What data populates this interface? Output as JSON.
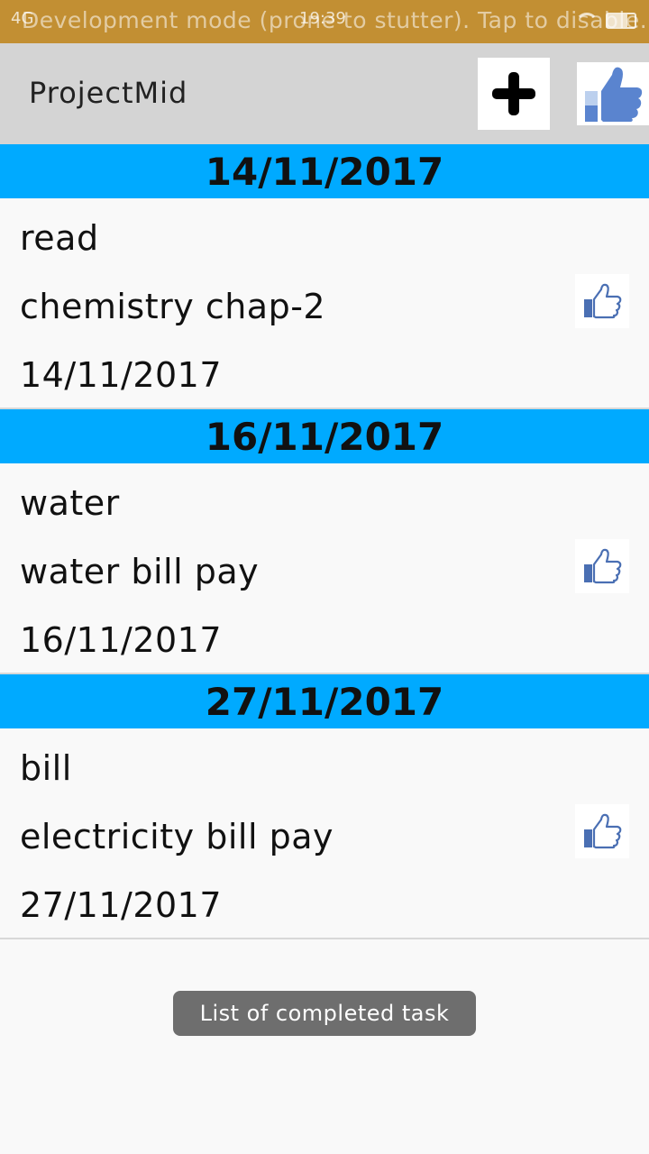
{
  "status_bar": {
    "network": "4G",
    "dev_banner": "Development mode (prone to stutter). Tap to disable.",
    "clock": "19:39"
  },
  "app_bar": {
    "title": "ProjectMid",
    "add_icon": "plus-icon",
    "like_icon": "thumbs-up-icon"
  },
  "tasks": [
    {
      "date_header": "14/11/2017",
      "title": "read",
      "description": "chemistry chap-2",
      "date": "14/11/2017"
    },
    {
      "date_header": "16/11/2017",
      "title": "water",
      "description": "water bill pay",
      "date": "16/11/2017"
    },
    {
      "date_header": "27/11/2017",
      "title": "bill",
      "description": "electricity bill pay",
      "date": "27/11/2017"
    }
  ],
  "toast": {
    "message": "List of completed task"
  },
  "colors": {
    "status_bar": "#c28f33",
    "app_bar": "#d4d4d4",
    "date_header": "#00aaff",
    "toast": "#6e6e6e",
    "thumb_blue": "#4a6fb3"
  }
}
